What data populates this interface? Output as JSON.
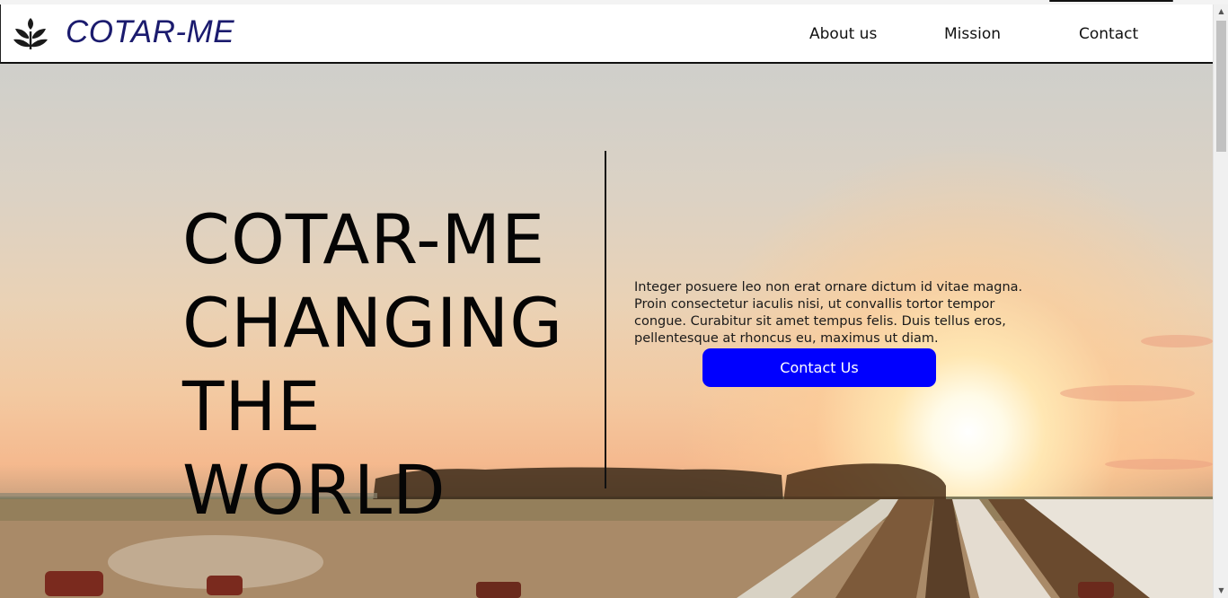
{
  "navbar": {
    "brand": "COTAR-ME",
    "logo_icon": "sprout-leaves-icon",
    "links": [
      "About us",
      "Mission",
      "Contact"
    ]
  },
  "hero": {
    "title_lines": [
      "COTAR-ME",
      "CHANGING",
      "THE",
      "WORLD"
    ],
    "description": "Integer posuere leo non erat ornare dictum id vitae magna. Proin consectetur iaculis nisi, ut convallis tortor tempor congue. Curabitur sit amet tempus felis. Duis tellus eros, pellentesque at rhoncus eu, maximus ut diam.",
    "cta_label": "Contact Us",
    "background": "sunset-cotton-field-photo"
  },
  "colors": {
    "brand": "#1b1b6e",
    "cta": "#0000ff",
    "text": "#050505"
  }
}
